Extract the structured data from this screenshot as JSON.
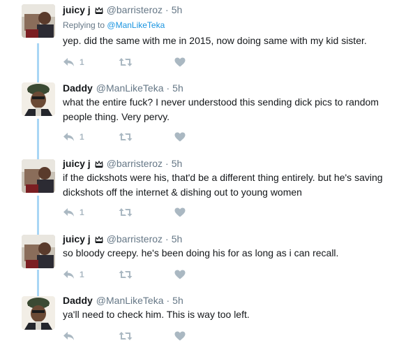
{
  "colors": {
    "name": "#14171a",
    "muted": "#657786",
    "link": "#1b95e0",
    "action_gray": "#aab8c2",
    "thread_line": "#a9d6f5"
  },
  "tweets": [
    {
      "name": "juicy j",
      "badge_icon": "crown-icon",
      "handle": "@barristeroz",
      "dot": "·",
      "time": "5h",
      "replying_prefix": "Replying to",
      "replying_mention": "@ManLikeTeka",
      "text": "yep. did the same with me in 2015, now doing same with my kid sister.",
      "reply_count": "1"
    },
    {
      "name": "Daddy",
      "handle": "@ManLikeTeka",
      "dot": "·",
      "time": "5h",
      "text": "what the entire fuck? I never understood this sending dick pics to random people thing. Very pervy.",
      "reply_count": "1"
    },
    {
      "name": "juicy j",
      "badge_icon": "crown-icon",
      "handle": "@barristeroz",
      "dot": "·",
      "time": "5h",
      "text": "if the dickshots were his, that'd be a different thing entirely. but he's saving dickshots off the internet & dishing out to young women",
      "reply_count": "1"
    },
    {
      "name": "juicy j",
      "badge_icon": "crown-icon",
      "handle": "@barristeroz",
      "dot": "·",
      "time": "5h",
      "text": "so bloody creepy. he's been doing his for as long as i can recall.",
      "reply_count": "1"
    },
    {
      "name": "Daddy",
      "handle": "@ManLikeTeka",
      "dot": "·",
      "time": "5h",
      "text": "ya'll need to check him. This is way too left."
    }
  ]
}
